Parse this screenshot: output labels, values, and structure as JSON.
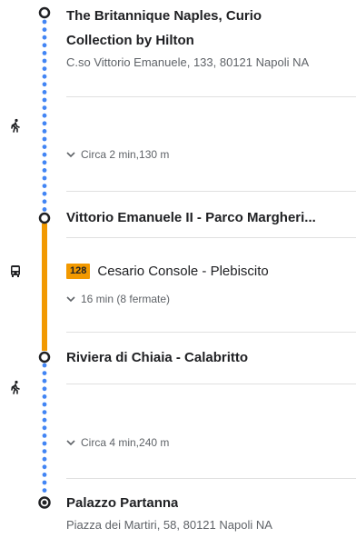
{
  "colors": {
    "walk_line": "#4285f4",
    "transit_line": "#f29900",
    "badge_bg": "#f29900",
    "text_primary": "#202124",
    "text_secondary": "#5f6368"
  },
  "stops": [
    {
      "title_line1": "The Britannique Naples, Curio",
      "title_line2": "Collection by Hilton",
      "address": "C.so Vittorio Emanuele, 133, 80121 Napoli NA",
      "marker_icon": "hollow-circle"
    },
    {
      "title": "Vittorio Emanuele II - Parco Margheri...",
      "marker_icon": "hollow-circle"
    },
    {
      "title": "Riviera di Chiaia - Calabritto",
      "marker_icon": "hollow-circle"
    },
    {
      "title": "Palazzo Partanna",
      "address": "Piazza dei Martiri, 58, 80121 Napoli NA",
      "marker_icon": "destination-dot-circle"
    }
  ],
  "segments": [
    {
      "mode": "walk",
      "icon": "walk-icon",
      "summary": "Circa 2 min,130 m"
    },
    {
      "mode": "bus",
      "icon": "bus-icon",
      "line": "128",
      "headsign": "Cesario Console - Plebiscito",
      "summary": "16 min (8 fermate)"
    },
    {
      "mode": "walk",
      "icon": "walk-icon",
      "summary": "Circa 4 min,240 m"
    }
  ]
}
